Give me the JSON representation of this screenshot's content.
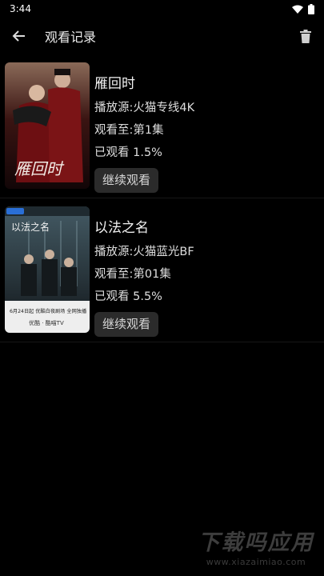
{
  "status": {
    "time": "3:44"
  },
  "header": {
    "title": "观看记录"
  },
  "history": [
    {
      "title": "雁回时",
      "source": "播放源:火猫专线4K",
      "progress_ep": "观看至:第1集",
      "percent": "已观看 1.5%",
      "button": "继续观看",
      "poster_text": "雁回时"
    },
    {
      "title": "以法之名",
      "source": "播放源:火猫蓝光BF",
      "progress_ep": "观看至:第01集",
      "percent": "已观看 5.5%",
      "button": "继续观看",
      "poster_text": "以法之名",
      "poster_footer": "6月24日起 优酷白夜剧场 全网独播",
      "poster_brands": "优酷 · 酷喵TV"
    }
  ],
  "watermark": {
    "main": "下载吗应用",
    "url": "www.xiazaimiao.com"
  },
  "colors": {
    "background": "#000000",
    "button_bg": "#2b2b2b"
  }
}
